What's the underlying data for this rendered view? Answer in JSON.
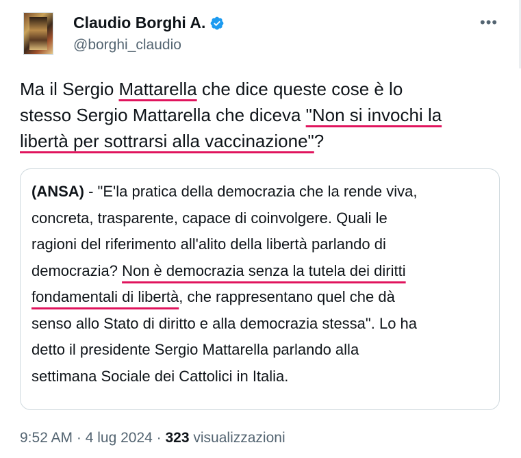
{
  "author": {
    "name": "Claudio Borghi A.",
    "handle": "@borghi_claudio",
    "verified_icon": "verified-badge-icon"
  },
  "more_label": "•••",
  "tweet": {
    "line1": {
      "a": "Ma il Sergio ",
      "b": "Mattarella",
      "c": " che dice queste cose è lo"
    },
    "line2": {
      "a": "stesso Sergio Mattarella che diceva ",
      "b": "\"Non si invochi la"
    },
    "line3": {
      "a": "libertà per sottrarsi alla vaccinazione\"",
      "b": "?"
    }
  },
  "quote": {
    "source": "(ANSA)",
    "line1_rest": " - \"E'la pratica della democrazia che la rende viva,",
    "line2": "concreta, trasparente, capace di coinvolgere. Quali le",
    "line3": "ragioni del riferimento all'alito della libertà parlando di",
    "line4_a": "democrazia? ",
    "line4_b": "Non è democrazia senza la tutela dei diritti",
    "line5_a": "fondamentali di libertà",
    "line5_b": ", che rappresentano quel che dà",
    "line6": "senso allo Stato di diritto e alla democrazia stessa\". Lo ha",
    "line7": "detto il presidente Sergio Mattarella parlando alla",
    "line8": "settimana Sociale dei Cattolici in Italia."
  },
  "meta": {
    "time": "9:52 AM",
    "separator": " · ",
    "date": "4 lug 2024",
    "views_count": "323",
    "views_label": " visualizzazioni"
  },
  "colors": {
    "highlight_underline": "#e0145d",
    "verified_blue": "#1d9bf0",
    "secondary_text": "#536471",
    "border": "#cfd9de"
  }
}
